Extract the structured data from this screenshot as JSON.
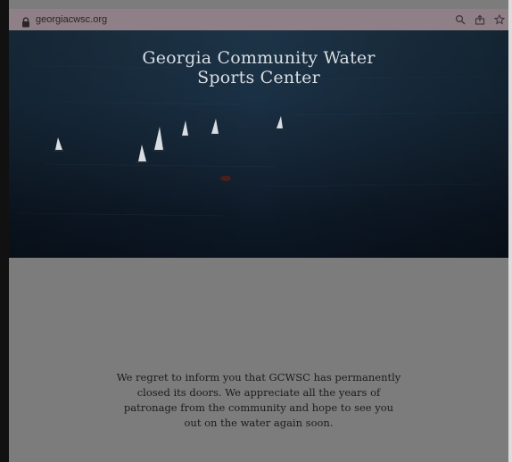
{
  "browser": {
    "url": "georgiacwsc.org",
    "icons": [
      "lock-icon",
      "zoom-icon",
      "share-icon",
      "bookmark-star-icon"
    ]
  },
  "hero": {
    "title_line1": "Georgia Community Water",
    "title_line2": "Sports Center"
  },
  "content": {
    "message": "We regret to inform you that GCWSC has permanently closed its doors. We appreciate all the years of patronage from the community and hope to see you out on the water again soon."
  },
  "colors": {
    "address_bar": "#8f7f86",
    "page_background": "#7c7c7c",
    "hero_water": "#152637"
  }
}
